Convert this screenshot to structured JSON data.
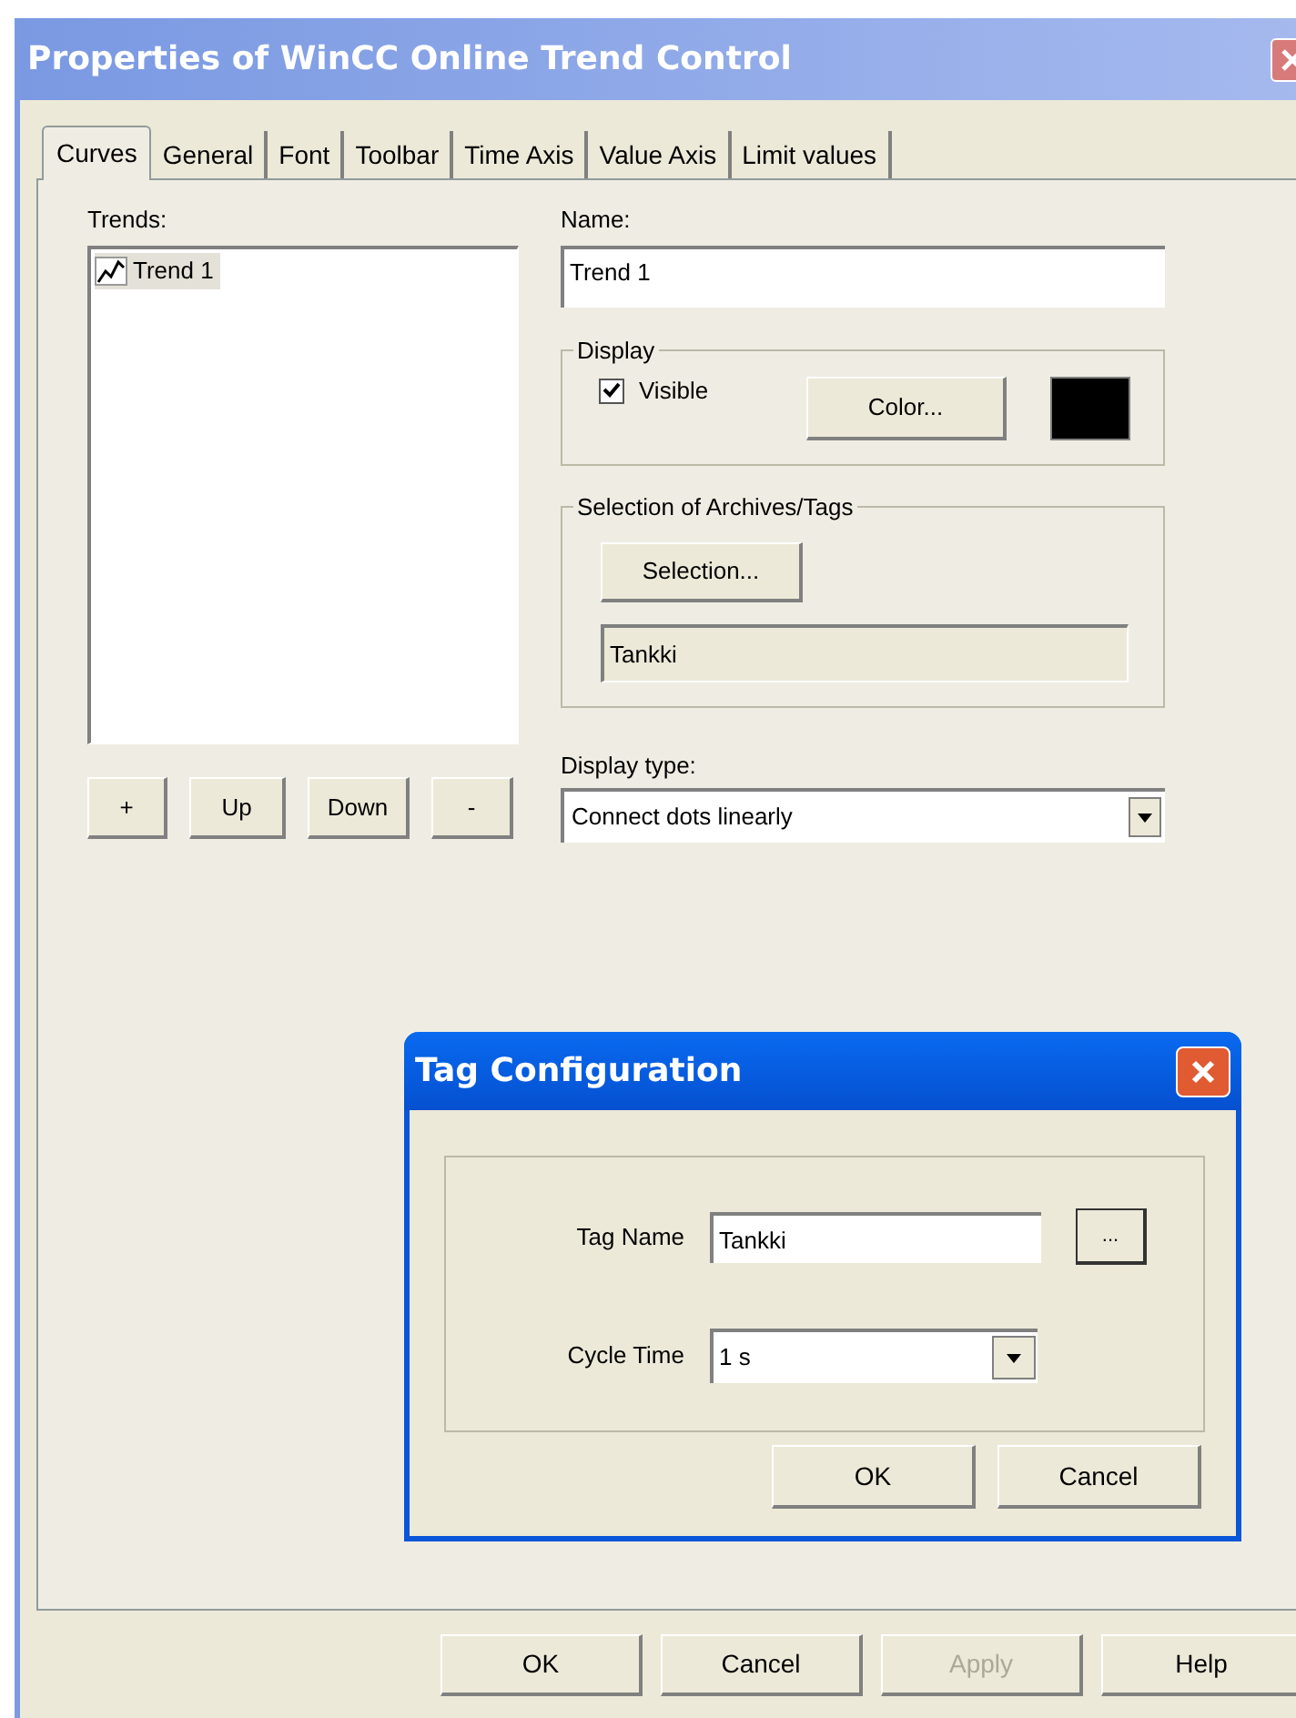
{
  "window": {
    "title": "Properties of WinCC Online Trend Control"
  },
  "tabs": [
    {
      "label": "Curves",
      "selected": true
    },
    {
      "label": "General",
      "selected": false
    },
    {
      "label": "Font",
      "selected": false
    },
    {
      "label": "Toolbar",
      "selected": false
    },
    {
      "label": "Time Axis",
      "selected": false
    },
    {
      "label": "Value Axis",
      "selected": false
    },
    {
      "label": "Limit values",
      "selected": false
    }
  ],
  "curves": {
    "trends_label": "Trends:",
    "trends": [
      {
        "label": "Trend 1",
        "selected": true
      }
    ],
    "list_buttons": [
      "+",
      "Up",
      "Down",
      "-"
    ],
    "name_label": "Name:",
    "name_value": "Trend 1",
    "display": {
      "title": "Display",
      "visible_label": "Visible",
      "visible_checked": true,
      "color_button": "Color...",
      "color": "#000000"
    },
    "selection": {
      "title": "Selection of Archives/Tags",
      "button": "Selection...",
      "value": "Tankki"
    },
    "display_type": {
      "label": "Display type:",
      "value": "Connect dots linearly"
    }
  },
  "tag_dialog": {
    "title": "Tag Configuration",
    "tag_name_label": "Tag Name",
    "tag_name_value": "Tankki",
    "browse_button": "...",
    "cycle_time_label": "Cycle Time",
    "cycle_time_value": "1 s",
    "buttons": [
      "OK",
      "Cancel"
    ]
  },
  "buttons": [
    {
      "label": "OK",
      "disabled": false
    },
    {
      "label": "Cancel",
      "disabled": false
    },
    {
      "label": "Apply",
      "disabled": true
    },
    {
      "label": "Help",
      "disabled": false
    }
  ]
}
